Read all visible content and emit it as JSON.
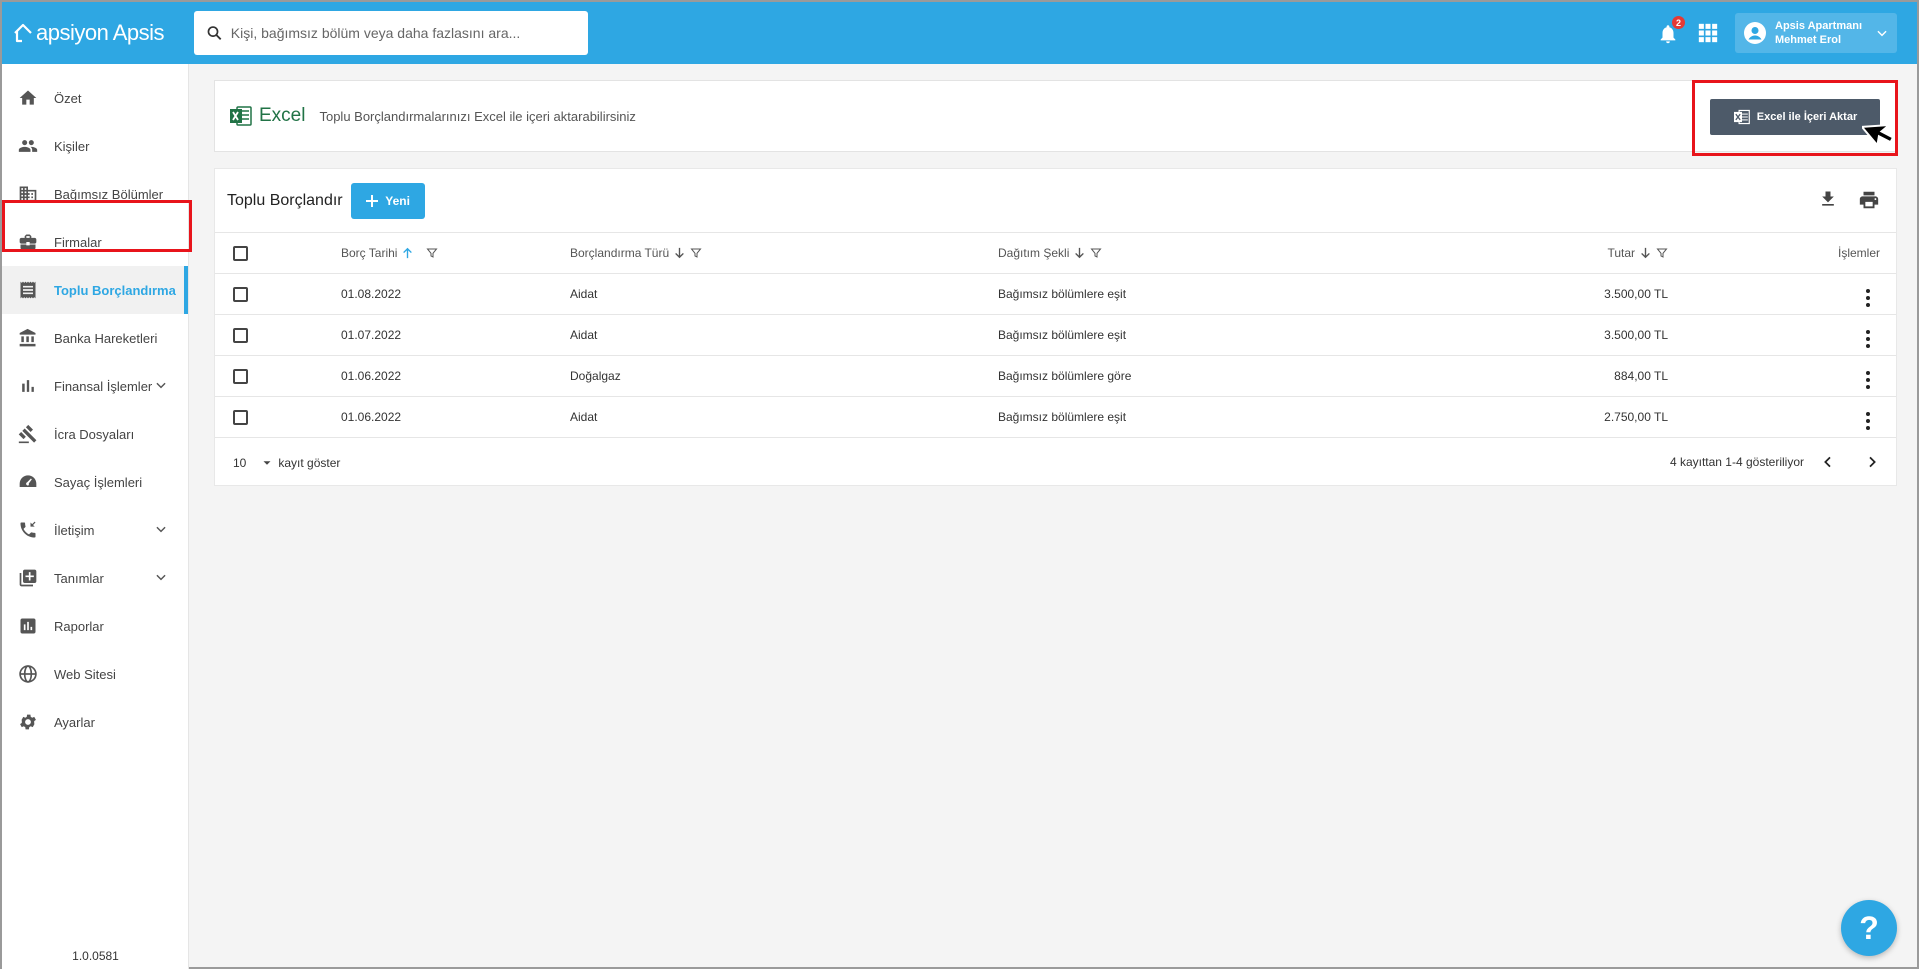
{
  "brand": {
    "name": "apsiyon Apsis"
  },
  "search": {
    "placeholder": "Kişi, bağımsız bölüm veya daha fazlasını ara..."
  },
  "header": {
    "notification_count": "2",
    "user_line1": "Apsis Apartmanı",
    "user_line2": "Mehmet Erol"
  },
  "sidebar": {
    "items": [
      {
        "label": "Özet",
        "icon": "home-icon"
      },
      {
        "label": "Kişiler",
        "icon": "people-icon"
      },
      {
        "label": "Bağımsız Bölümler",
        "icon": "building-icon"
      },
      {
        "label": "Firmalar",
        "icon": "briefcase-icon"
      },
      {
        "label": "Toplu Borçlandırma",
        "icon": "receipt-icon",
        "active": true
      },
      {
        "label": "Banka Hareketleri",
        "icon": "bank-icon"
      },
      {
        "label": "Finansal İşlemler",
        "icon": "bar-chart-icon"
      },
      {
        "label": "İcra Dosyaları",
        "icon": "gavel-icon"
      },
      {
        "label": "Sayaç İşlemleri",
        "icon": "meter-icon"
      },
      {
        "label": "İletişim",
        "icon": "phone-icon"
      },
      {
        "label": "Tanımlar",
        "icon": "add-box-icon"
      },
      {
        "label": "Raporlar",
        "icon": "report-icon"
      },
      {
        "label": "Web Sitesi",
        "icon": "globe-icon"
      },
      {
        "label": "Ayarlar",
        "icon": "gear-icon"
      }
    ],
    "version": "1.0.0581"
  },
  "excel_bar": {
    "title": "Excel",
    "description": "Toplu Borçlandırmalarınızı Excel ile içeri aktarabilirsiniz",
    "button_label": "Excel ile İçeri Aktar"
  },
  "card": {
    "title": "Toplu Borçlandır",
    "new_button": "Yeni",
    "columns": {
      "date": "Borç Tarihi",
      "type": "Borçlandırma Türü",
      "distribution": "Dağıtım Şekli",
      "amount": "Tutar",
      "actions": "İşlemler"
    },
    "rows": [
      {
        "date": "01.08.2022",
        "type": "Aidat",
        "distribution": "Bağımsız bölümlere eşit",
        "amount": "3.500,00 TL"
      },
      {
        "date": "01.07.2022",
        "type": "Aidat",
        "distribution": "Bağımsız bölümlere eşit",
        "amount": "3.500,00 TL"
      },
      {
        "date": "01.06.2022",
        "type": "Doğalgaz",
        "distribution": "Bağımsız bölümlere göre",
        "amount": "884,00 TL"
      },
      {
        "date": "01.06.2022",
        "type": "Aidat",
        "distribution": "Bağımsız bölümlere eşit",
        "amount": "2.750,00 TL"
      }
    ],
    "page_size": "10",
    "page_size_label": "kayıt göster",
    "page_info": "4 kayıttan 1-4 gösteriliyor"
  },
  "help": {
    "label": "?"
  },
  "colors": {
    "primary": "#2ea7e3",
    "highlight": "#e8141b",
    "excel": "#217346",
    "button_dark": "#4d5a69"
  }
}
